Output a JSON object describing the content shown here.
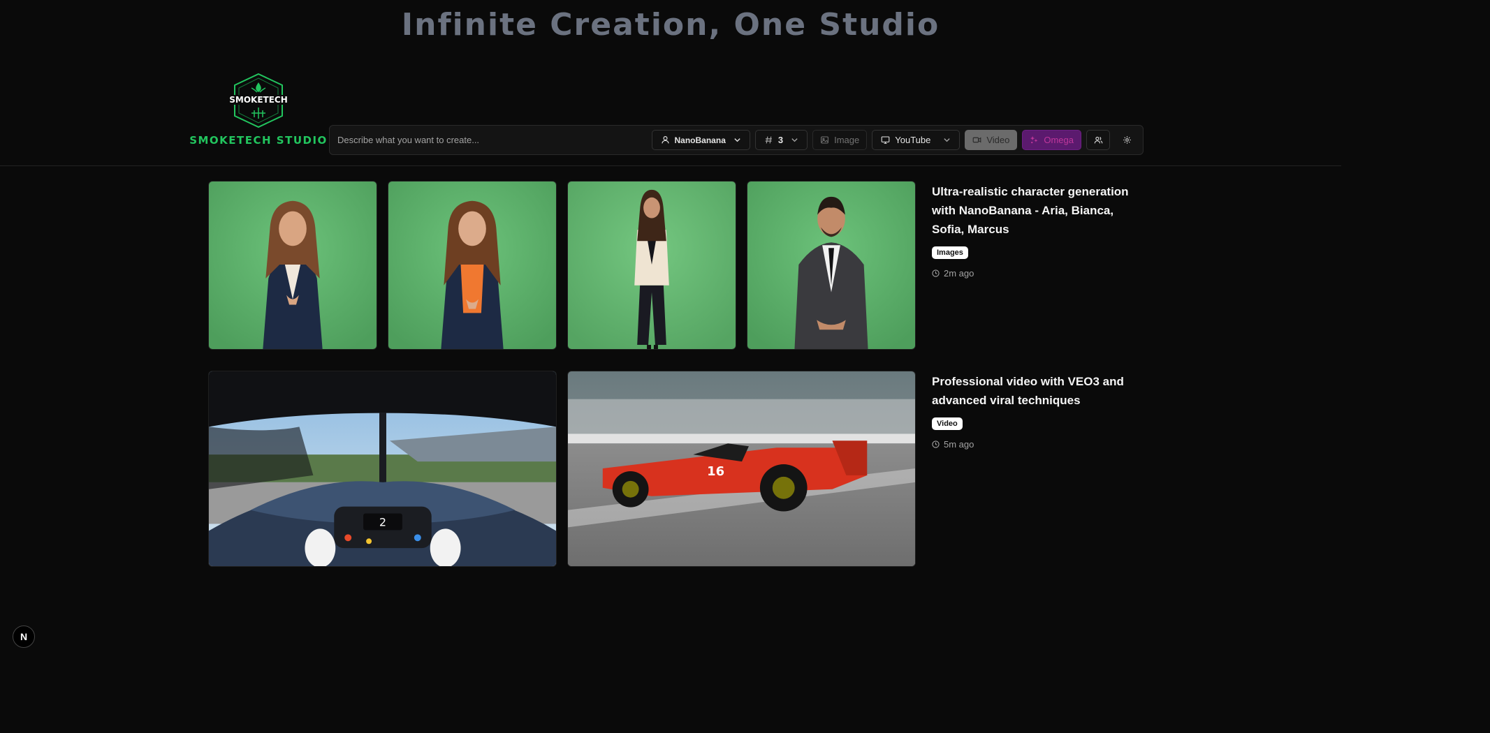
{
  "hero": {
    "title": "Infinite Creation, One Studio"
  },
  "brand": {
    "name": "SMOKETECH STUDIO",
    "logo_text": "SMOKETECH"
  },
  "toolbar": {
    "prompt_placeholder": "Describe what you want to create...",
    "model_label": "NanoBanana",
    "count_label": "3",
    "image_label": "Image",
    "platform_label": "YouTube",
    "video_label": "Video",
    "omega_label": "Omega",
    "icons": [
      "user-icon",
      "hash-icon",
      "image-icon",
      "monitor-icon",
      "video-camera-icon",
      "sparkle-icon",
      "users-icon",
      "settings-icon"
    ]
  },
  "posts": [
    {
      "title": "Ultra-realistic character generation with NanoBanana - Aria, Bianca, Sofia, Marcus",
      "badge": "Images",
      "time": "2m ago",
      "media": [
        "woman-white-blouse-navy-blazer",
        "woman-orange-top-navy-blazer",
        "woman-cream-blazer-full-body",
        "man-grey-suit"
      ]
    },
    {
      "title": "Professional video with VEO3 and advanced viral techniques",
      "badge": "Video",
      "time": "5m ago",
      "media": [
        "f1-cockpit-view",
        "red-f1-car-on-track"
      ]
    }
  ],
  "colors": {
    "background": "#0a0a0a",
    "brand_green": "#22c55e",
    "omega_purple": "#5b1a6e",
    "green_screen": "#5fb56a"
  },
  "floating_badge": "N"
}
